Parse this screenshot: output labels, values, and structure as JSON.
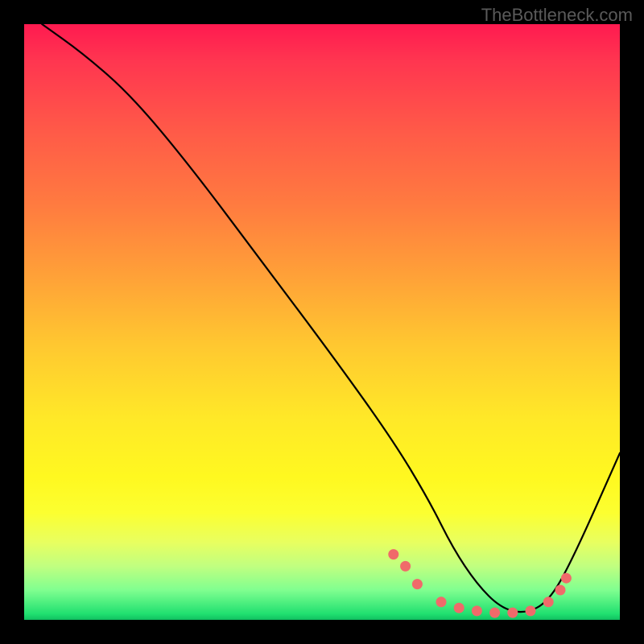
{
  "watermark": "TheBottleneck.com",
  "chart_data": {
    "type": "line",
    "title": "",
    "xlabel": "",
    "ylabel": "",
    "xlim": [
      0,
      100
    ],
    "ylim": [
      0,
      100
    ],
    "series": [
      {
        "name": "curve",
        "x": [
          3,
          10,
          18,
          28,
          40,
          52,
          62,
          68,
          72,
          76,
          80,
          84,
          88,
          92,
          100
        ],
        "values": [
          100,
          95,
          88,
          76,
          60,
          44,
          30,
          20,
          12,
          6,
          2,
          1,
          3,
          10,
          28
        ]
      }
    ],
    "markers": {
      "name": "highlight-dots",
      "color": "#f06a6a",
      "points": [
        {
          "x": 62,
          "y": 11
        },
        {
          "x": 64,
          "y": 9
        },
        {
          "x": 66,
          "y": 6
        },
        {
          "x": 70,
          "y": 3
        },
        {
          "x": 73,
          "y": 2
        },
        {
          "x": 76,
          "y": 1.5
        },
        {
          "x": 79,
          "y": 1.2
        },
        {
          "x": 82,
          "y": 1.2
        },
        {
          "x": 85,
          "y": 1.5
        },
        {
          "x": 88,
          "y": 3
        },
        {
          "x": 90,
          "y": 5
        },
        {
          "x": 91,
          "y": 7
        }
      ]
    },
    "gradient_stops": [
      {
        "pos": 0,
        "color": "#ff1a50"
      },
      {
        "pos": 50,
        "color": "#ffc830"
      },
      {
        "pos": 80,
        "color": "#fff820"
      },
      {
        "pos": 100,
        "color": "#10c060"
      }
    ]
  }
}
